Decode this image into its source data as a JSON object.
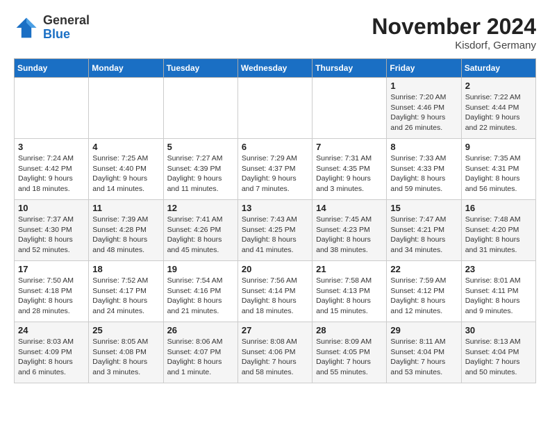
{
  "header": {
    "logo": {
      "general": "General",
      "blue": "Blue"
    },
    "month_year": "November 2024",
    "location": "Kisdorf, Germany"
  },
  "weekdays": [
    "Sunday",
    "Monday",
    "Tuesday",
    "Wednesday",
    "Thursday",
    "Friday",
    "Saturday"
  ],
  "weeks": [
    [
      {
        "day": "",
        "info": ""
      },
      {
        "day": "",
        "info": ""
      },
      {
        "day": "",
        "info": ""
      },
      {
        "day": "",
        "info": ""
      },
      {
        "day": "",
        "info": ""
      },
      {
        "day": "1",
        "info": "Sunrise: 7:20 AM\nSunset: 4:46 PM\nDaylight: 9 hours\nand 26 minutes."
      },
      {
        "day": "2",
        "info": "Sunrise: 7:22 AM\nSunset: 4:44 PM\nDaylight: 9 hours\nand 22 minutes."
      }
    ],
    [
      {
        "day": "3",
        "info": "Sunrise: 7:24 AM\nSunset: 4:42 PM\nDaylight: 9 hours\nand 18 minutes."
      },
      {
        "day": "4",
        "info": "Sunrise: 7:25 AM\nSunset: 4:40 PM\nDaylight: 9 hours\nand 14 minutes."
      },
      {
        "day": "5",
        "info": "Sunrise: 7:27 AM\nSunset: 4:39 PM\nDaylight: 9 hours\nand 11 minutes."
      },
      {
        "day": "6",
        "info": "Sunrise: 7:29 AM\nSunset: 4:37 PM\nDaylight: 9 hours\nand 7 minutes."
      },
      {
        "day": "7",
        "info": "Sunrise: 7:31 AM\nSunset: 4:35 PM\nDaylight: 9 hours\nand 3 minutes."
      },
      {
        "day": "8",
        "info": "Sunrise: 7:33 AM\nSunset: 4:33 PM\nDaylight: 8 hours\nand 59 minutes."
      },
      {
        "day": "9",
        "info": "Sunrise: 7:35 AM\nSunset: 4:31 PM\nDaylight: 8 hours\nand 56 minutes."
      }
    ],
    [
      {
        "day": "10",
        "info": "Sunrise: 7:37 AM\nSunset: 4:30 PM\nDaylight: 8 hours\nand 52 minutes."
      },
      {
        "day": "11",
        "info": "Sunrise: 7:39 AM\nSunset: 4:28 PM\nDaylight: 8 hours\nand 48 minutes."
      },
      {
        "day": "12",
        "info": "Sunrise: 7:41 AM\nSunset: 4:26 PM\nDaylight: 8 hours\nand 45 minutes."
      },
      {
        "day": "13",
        "info": "Sunrise: 7:43 AM\nSunset: 4:25 PM\nDaylight: 8 hours\nand 41 minutes."
      },
      {
        "day": "14",
        "info": "Sunrise: 7:45 AM\nSunset: 4:23 PM\nDaylight: 8 hours\nand 38 minutes."
      },
      {
        "day": "15",
        "info": "Sunrise: 7:47 AM\nSunset: 4:21 PM\nDaylight: 8 hours\nand 34 minutes."
      },
      {
        "day": "16",
        "info": "Sunrise: 7:48 AM\nSunset: 4:20 PM\nDaylight: 8 hours\nand 31 minutes."
      }
    ],
    [
      {
        "day": "17",
        "info": "Sunrise: 7:50 AM\nSunset: 4:18 PM\nDaylight: 8 hours\nand 28 minutes."
      },
      {
        "day": "18",
        "info": "Sunrise: 7:52 AM\nSunset: 4:17 PM\nDaylight: 8 hours\nand 24 minutes."
      },
      {
        "day": "19",
        "info": "Sunrise: 7:54 AM\nSunset: 4:16 PM\nDaylight: 8 hours\nand 21 minutes."
      },
      {
        "day": "20",
        "info": "Sunrise: 7:56 AM\nSunset: 4:14 PM\nDaylight: 8 hours\nand 18 minutes."
      },
      {
        "day": "21",
        "info": "Sunrise: 7:58 AM\nSunset: 4:13 PM\nDaylight: 8 hours\nand 15 minutes."
      },
      {
        "day": "22",
        "info": "Sunrise: 7:59 AM\nSunset: 4:12 PM\nDaylight: 8 hours\nand 12 minutes."
      },
      {
        "day": "23",
        "info": "Sunrise: 8:01 AM\nSunset: 4:11 PM\nDaylight: 8 hours\nand 9 minutes."
      }
    ],
    [
      {
        "day": "24",
        "info": "Sunrise: 8:03 AM\nSunset: 4:09 PM\nDaylight: 8 hours\nand 6 minutes."
      },
      {
        "day": "25",
        "info": "Sunrise: 8:05 AM\nSunset: 4:08 PM\nDaylight: 8 hours\nand 3 minutes."
      },
      {
        "day": "26",
        "info": "Sunrise: 8:06 AM\nSunset: 4:07 PM\nDaylight: 8 hours\nand 1 minute."
      },
      {
        "day": "27",
        "info": "Sunrise: 8:08 AM\nSunset: 4:06 PM\nDaylight: 7 hours\nand 58 minutes."
      },
      {
        "day": "28",
        "info": "Sunrise: 8:09 AM\nSunset: 4:05 PM\nDaylight: 7 hours\nand 55 minutes."
      },
      {
        "day": "29",
        "info": "Sunrise: 8:11 AM\nSunset: 4:04 PM\nDaylight: 7 hours\nand 53 minutes."
      },
      {
        "day": "30",
        "info": "Sunrise: 8:13 AM\nSunset: 4:04 PM\nDaylight: 7 hours\nand 50 minutes."
      }
    ]
  ]
}
